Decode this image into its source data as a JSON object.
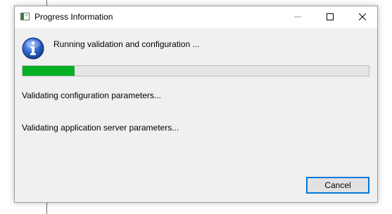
{
  "window": {
    "title": "Progress Information"
  },
  "controls": {
    "minimize_icon": "minimize-icon",
    "maximize_icon": "maximize-icon",
    "close_icon": "close-icon"
  },
  "main": {
    "message": "Running validation and configuration ...",
    "info_icon": "info-icon",
    "progress": 0.15,
    "progress_color": "#06b025",
    "status_lines": [
      "Validating configuration parameters...",
      "Validating application server parameters..."
    ]
  },
  "footer": {
    "cancel_label": "Cancel"
  }
}
